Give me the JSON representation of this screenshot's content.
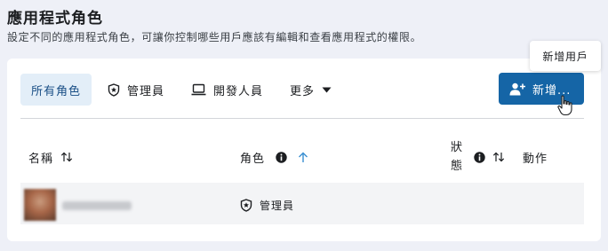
{
  "header": {
    "title": "應用程式角色",
    "subtitle": "設定不同的應用程式角色，可讓你控制哪些用戶應該有編輯和查看應用程式的權限。"
  },
  "tabs": [
    {
      "label": "所有角色",
      "active": true,
      "icon": null
    },
    {
      "label": "管理員",
      "active": false,
      "icon": "shield-icon"
    },
    {
      "label": "開發人員",
      "active": false,
      "icon": "laptop-icon"
    },
    {
      "label": "更多",
      "active": false,
      "icon": "caret-down-icon"
    }
  ],
  "add_button": {
    "label": "新增...",
    "icon": "add-user-icon",
    "color": "#1565a6"
  },
  "tooltip": {
    "text": "新增用戶"
  },
  "table": {
    "columns": {
      "name": "名稱",
      "role": "角色",
      "status_line1": "狀",
      "status_line2": "態",
      "action": "動作"
    },
    "rows": [
      {
        "name": "",
        "role": "管理員",
        "action": ""
      }
    ]
  },
  "colors": {
    "accent": "#1565a6",
    "sort_active": "#3a8fd1",
    "page_bg": "#eef0f7",
    "tab_active_bg": "#e3eef8"
  }
}
